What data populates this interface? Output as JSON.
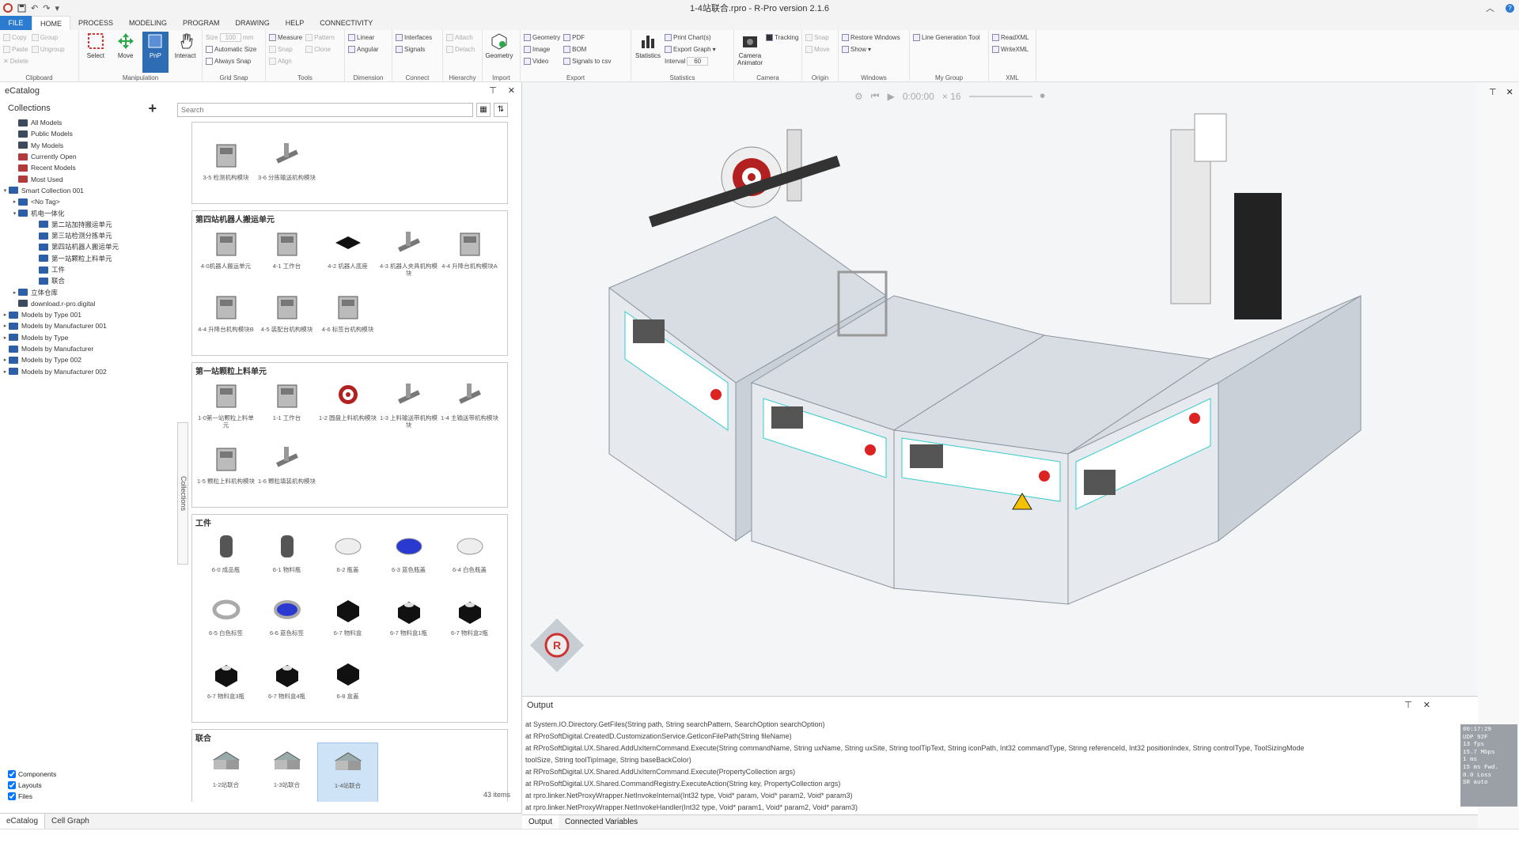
{
  "titlebar": {
    "title": "1-4站联合.rpro - R-Pro version 2.1.6",
    "quick_access": [
      "save",
      "undo",
      "redo"
    ]
  },
  "menu_tabs": [
    "FILE",
    "HOME",
    "PROCESS",
    "MODELING",
    "PROGRAM",
    "DRAWING",
    "HELP",
    "CONNECTIVITY"
  ],
  "ribbon": {
    "clipboard": {
      "label": "Clipboard",
      "copy": "Copy",
      "paste": "Paste",
      "delete": "Delete",
      "group": "Group",
      "ungroup": "Ungroup"
    },
    "manipulation": {
      "label": "Manipulation",
      "select": "Select",
      "move": "Move",
      "pnp": "PnP",
      "interact": "Interact"
    },
    "grid_snap": {
      "label": "Grid Snap",
      "size": "Size",
      "size_value": "100",
      "size_unit": "mm",
      "auto_size": "Automatic Size",
      "always_snap": "Always Snap"
    },
    "tools": {
      "label": "Tools",
      "measure": "Measure",
      "snap": "Snap",
      "align": "Align",
      "pattern": "Pattern",
      "clone": "Clone"
    },
    "dimension": {
      "label": "Dimension",
      "linear": "Linear",
      "angular": "Angular"
    },
    "connect": {
      "label": "Connect",
      "interfaces": "Interfaces",
      "signals": "Signals"
    },
    "hierarchy": {
      "label": "Hierarchy",
      "attach": "Attach",
      "detach": "Detach"
    },
    "import": {
      "label": "Import",
      "geometry": "Geometry"
    },
    "export": {
      "label": "Export",
      "geometry": "Geometry",
      "image": "Image",
      "video": "Video",
      "pdf": "PDF",
      "bom": "BOM",
      "signals_csv": "Signals to csv"
    },
    "statistics": {
      "label": "Statistics",
      "statistics": "Statistics",
      "print_charts": "Print Chart(s)",
      "export_graph": "Export Graph",
      "interval": "Interval",
      "interval_value": "60"
    },
    "camera": {
      "label": "Camera",
      "camera_animator": "Camera Animator",
      "tracking": "Tracking"
    },
    "origin": {
      "label": "Origin",
      "snap": "Snap",
      "move": "Move"
    },
    "windows": {
      "label": "Windows",
      "restore": "Restore Windows",
      "show": "Show"
    },
    "my_group": {
      "label": "My Group",
      "line_gen": "Line Generation Tool"
    },
    "xml": {
      "label": "XML",
      "read": "ReadXML",
      "write": "WriteXML"
    }
  },
  "catalog": {
    "title": "eCatalog",
    "collections_label": "Collections",
    "search_placeholder": "Search",
    "side_tab": "Collections",
    "tree": [
      {
        "label": "All Models",
        "indent": 1,
        "color": "#3b4a5c",
        "arrow": ""
      },
      {
        "label": "Public Models",
        "indent": 1,
        "color": "#3b4a5c",
        "arrow": ""
      },
      {
        "label": "My Models",
        "indent": 1,
        "color": "#3b4a5c",
        "arrow": ""
      },
      {
        "label": "Currently Open",
        "indent": 1,
        "color": "#b33a3a",
        "arrow": ""
      },
      {
        "label": "Recent Models",
        "indent": 1,
        "color": "#b33a3a",
        "arrow": ""
      },
      {
        "label": "Most Used",
        "indent": 1,
        "color": "#b33a3a",
        "arrow": ""
      },
      {
        "label": "Smart Collection 001",
        "indent": 0,
        "color": "#2c5fa8",
        "arrow": "▾"
      },
      {
        "label": "<No Tag>",
        "indent": 1,
        "color": "#2c5fa8",
        "arrow": "▸"
      },
      {
        "label": "机电一体化",
        "indent": 1,
        "color": "#2c5fa8",
        "arrow": "▾"
      },
      {
        "label": "第二站加持搬运单元",
        "indent": 2,
        "color": "#2c5fa8",
        "arrow": ""
      },
      {
        "label": "第三站检测分拣单元",
        "indent": 2,
        "color": "#2c5fa8",
        "arrow": ""
      },
      {
        "label": "第四站机器人搬运单元",
        "indent": 2,
        "color": "#2c5fa8",
        "arrow": ""
      },
      {
        "label": "第一站颗粒上料单元",
        "indent": 2,
        "color": "#2c5fa8",
        "arrow": ""
      },
      {
        "label": "工件",
        "indent": 2,
        "color": "#2c5fa8",
        "arrow": ""
      },
      {
        "label": "联合",
        "indent": 2,
        "color": "#2c5fa8",
        "arrow": ""
      },
      {
        "label": "立体仓库",
        "indent": 1,
        "color": "#2c5fa8",
        "arrow": "▸"
      },
      {
        "label": "download.r-pro.digital",
        "indent": 1,
        "color": "#3b4a5c",
        "arrow": ""
      },
      {
        "label": "Models by Type 001",
        "indent": 0,
        "color": "#2c5fa8",
        "arrow": "▸"
      },
      {
        "label": "Models by Manufacturer 001",
        "indent": 0,
        "color": "#2c5fa8",
        "arrow": "▸"
      },
      {
        "label": "Models by Type",
        "indent": 0,
        "color": "#2c5fa8",
        "arrow": "▸"
      },
      {
        "label": "Models by Manufacturer",
        "indent": 0,
        "color": "#2c5fa8",
        "arrow": ""
      },
      {
        "label": "Models by Type 002",
        "indent": 0,
        "color": "#2c5fa8",
        "arrow": "▸"
      },
      {
        "label": "Models by Manufacturer 002",
        "indent": 0,
        "color": "#2c5fa8",
        "arrow": "▸"
      }
    ],
    "filters": [
      "Components",
      "Layouts",
      "Files"
    ],
    "sections": [
      {
        "header": "",
        "items": [
          {
            "label": "3-5 检测机构模块",
            "kind": "device"
          },
          {
            "label": "3-6 分拣输送机构模块",
            "kind": "robot"
          }
        ]
      },
      {
        "header": "第四站机器人搬运单元",
        "items": [
          {
            "label": "4-0机器人搬运单元",
            "kind": "device"
          },
          {
            "label": "4-1 工作台",
            "kind": "device"
          },
          {
            "label": "4-2 机器人底座",
            "kind": "black"
          },
          {
            "label": "4-3 机器人夹具机构模块",
            "kind": "robot"
          },
          {
            "label": "4-4 升降台机构模块A",
            "kind": "device"
          },
          {
            "label": "4-4 升降台机构模块B",
            "kind": "device"
          },
          {
            "label": "4-5 装配台机构模块",
            "kind": "device"
          },
          {
            "label": "4-6 标签台机构模块",
            "kind": "device"
          }
        ]
      },
      {
        "header": "第一站颗粒上料单元",
        "items": [
          {
            "label": "1-0第一站颗粒上料单元",
            "kind": "device"
          },
          {
            "label": "1-1 工作台",
            "kind": "device"
          },
          {
            "label": "1-2 圆盘上料机构模块",
            "kind": "spiral"
          },
          {
            "label": "1-3 上料输送带机构模块",
            "kind": "robot"
          },
          {
            "label": "1-4 主输送带机构模块",
            "kind": "robot"
          },
          {
            "label": "1-5 颗粒上料机构模块",
            "kind": "device"
          },
          {
            "label": "1-6 颗粒填装机构模块",
            "kind": "robot"
          }
        ]
      },
      {
        "header": "工件",
        "items": [
          {
            "label": "6-0 成品瓶",
            "kind": "bottle"
          },
          {
            "label": "6-1 物料瓶",
            "kind": "bottle"
          },
          {
            "label": "6-2 瓶盖",
            "kind": "whitecap"
          },
          {
            "label": "6-3 蓝色瓶盖",
            "kind": "bluecap"
          },
          {
            "label": "6-4 白色瓶盖",
            "kind": "whitecap"
          },
          {
            "label": "6-5 白色标签",
            "kind": "whitering"
          },
          {
            "label": "6-6 蓝色标签",
            "kind": "bluering"
          },
          {
            "label": "6-7 物料盒",
            "kind": "box"
          },
          {
            "label": "6-7 物料盒1瓶",
            "kind": "boxfull"
          },
          {
            "label": "6-7 物料盒2瓶",
            "kind": "boxfull"
          },
          {
            "label": "6-7 物料盒3瓶",
            "kind": "boxfull"
          },
          {
            "label": "6-7 物料盒4瓶",
            "kind": "boxfull"
          },
          {
            "label": "6-8 盒盖",
            "kind": "box"
          }
        ]
      },
      {
        "header": "联合",
        "items": [
          {
            "label": "1-2站联合",
            "kind": "assembly"
          },
          {
            "label": "1-3站联合",
            "kind": "assembly"
          },
          {
            "label": "1-4站联合",
            "kind": "assembly",
            "selected": true
          }
        ]
      }
    ],
    "count": "43 items",
    "bottom_tabs": [
      "eCatalog",
      "Cell Graph"
    ]
  },
  "viewport": {
    "time": "0:00:00",
    "speed": "× 16"
  },
  "output": {
    "title": "Output",
    "lines": [
      "at System.IO.Directory.GetFiles(String path, String searchPattern, SearchOption searchOption)",
      "at RProSoftDigital.CreatedD.CustomizationService.GetIconFilePath(String fileName)",
      "at RProSoftDigital.UX.Shared.AddUxItemCommand.Execute(String commandName, String uxName, String uxSite, String toolTipText, String iconPath, Int32 commandType, String referenceId, Int32 positionIndex, String controlType, ToolSizingMode",
      "toolSize, String toolTipImage, String baseBackColor)",
      "at RProSoftDigital.UX.Shared.AddUxItemCommand.Execute(PropertyCollection args)",
      "at RProSoftDigital.UX.Shared.CommandRegistry.ExecuteAction(String key, PropertyCollection args)",
      "at rpro.linker.NetProxyWrapper.NetInvokeInternal(Int32 type, Void* param, Void* param2, Void* param3)",
      "at rpro.linker.NetProxyWrapper.NetInvokeHandler(Int32 type, Void* param1, Void* param2, Void* param3)"
    ],
    "tabs": [
      "Output",
      "Connected Variables"
    ]
  },
  "stats": [
    "00:17:29",
    "UDP 92F",
    "13 fps",
    "15.7 Mbps",
    "1 ms",
    "15 ms Fwd.",
    "0.0 Loss",
    "SR auto"
  ]
}
